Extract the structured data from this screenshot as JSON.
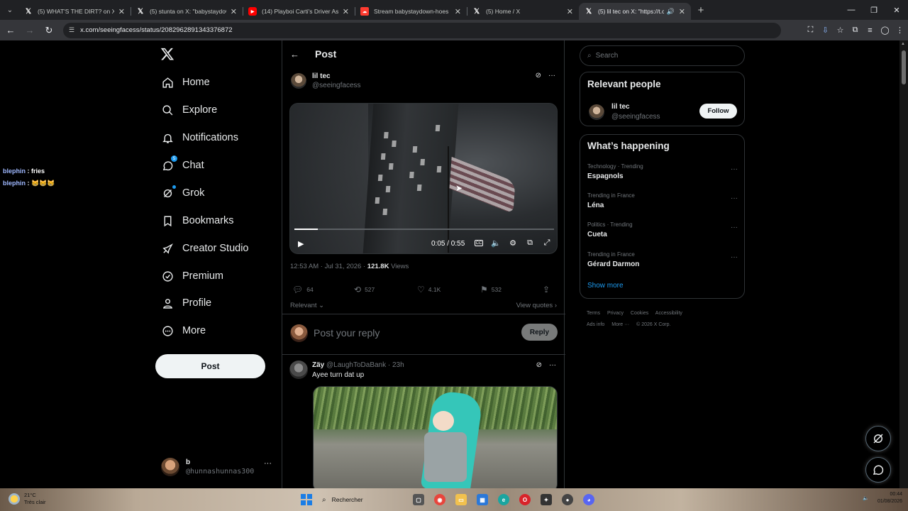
{
  "browser": {
    "tabs": [
      {
        "title": "(5) WHAT'S THE DIRT? on X: \"Th",
        "favicon": "x-icon",
        "active": false
      },
      {
        "title": "(5) stunta on X: \"babystaydown",
        "favicon": "x-icon",
        "active": false
      },
      {
        "title": "(14) Playboi Carti's Driver Assa",
        "favicon": "youtube-icon",
        "active": false
      },
      {
        "title": "Stream babystaydown-hoes an",
        "favicon": "soundcloud-icon",
        "active": false
      },
      {
        "title": "(5) Home / X",
        "favicon": "x-icon",
        "active": false
      },
      {
        "title": "(5) lil tec on X: \"https://t.co/",
        "favicon": "x-icon",
        "active": true
      }
    ],
    "url": "x.com/seeingfacess/status/2082962891343376872"
  },
  "chat_overlay": [
    {
      "nick": "blephin",
      "sep": " : ",
      "msg": "fries"
    },
    {
      "nick": "blephin",
      "sep": " : ",
      "msg": "😸😸😸"
    }
  ],
  "nav": {
    "items": [
      {
        "label": "Home",
        "icon": "home-icon"
      },
      {
        "label": "Explore",
        "icon": "search-icon"
      },
      {
        "label": "Notifications",
        "icon": "bell-icon"
      },
      {
        "label": "Chat",
        "icon": "chat-icon",
        "badge": "5"
      },
      {
        "label": "Grok",
        "icon": "grok-icon"
      },
      {
        "label": "Bookmarks",
        "icon": "bookmark-icon"
      },
      {
        "label": "Creator Studio",
        "icon": "rocket-icon"
      },
      {
        "label": "Premium",
        "icon": "verified-icon"
      },
      {
        "label": "Profile",
        "icon": "person-icon"
      },
      {
        "label": "More",
        "icon": "more-circle-icon"
      }
    ],
    "post_label": "Post",
    "account": {
      "name": "b",
      "handle": "@hunnashunnas300"
    }
  },
  "post": {
    "header_title": "Post",
    "author": {
      "name": "lil tec",
      "handle": "@seeingfacess"
    },
    "video": {
      "time": "0:05 / 0:55",
      "progress": 0.09
    },
    "timestamp": "12:53 AM · Jul 31, 2026 · ",
    "views_count": "121.8K",
    "views_label": " Views",
    "stats": {
      "replies": "64",
      "reposts": "527",
      "likes": "4.1K",
      "bookmarks": "532"
    },
    "sort_label": "Relevant",
    "view_quotes": "View quotes",
    "reply_placeholder": "Post your reply",
    "reply_button": "Reply"
  },
  "reply": {
    "name": "Zäy",
    "handle": "@LaughToDaBank · 23h",
    "text": "Ayee turn dat up"
  },
  "sidebar": {
    "search_placeholder": "Search",
    "relevant_title": "Relevant people",
    "relevant_user": {
      "name": "lil tec",
      "handle": "@seeingfacess"
    },
    "follow_label": "Follow",
    "happening_title": "What’s happening",
    "trends": [
      {
        "context": "Technology · Trending",
        "title": "Espagnols"
      },
      {
        "context": "Trending in France",
        "title": "Léna"
      },
      {
        "context": "Politics · Trending",
        "title": "Cueta"
      },
      {
        "context": "Trending in France",
        "title": "Gérard Darmon"
      }
    ],
    "show_more": "Show more",
    "footer": [
      "Terms",
      "Privacy",
      "Cookies",
      "Accessibility",
      "Ads info",
      "More ···",
      "© 2026 X Corp."
    ]
  },
  "taskbar": {
    "temp": "21°C",
    "weather": "Très clair",
    "search_label": "Rechercher",
    "time": "00:44",
    "date": "01/08/2026"
  }
}
